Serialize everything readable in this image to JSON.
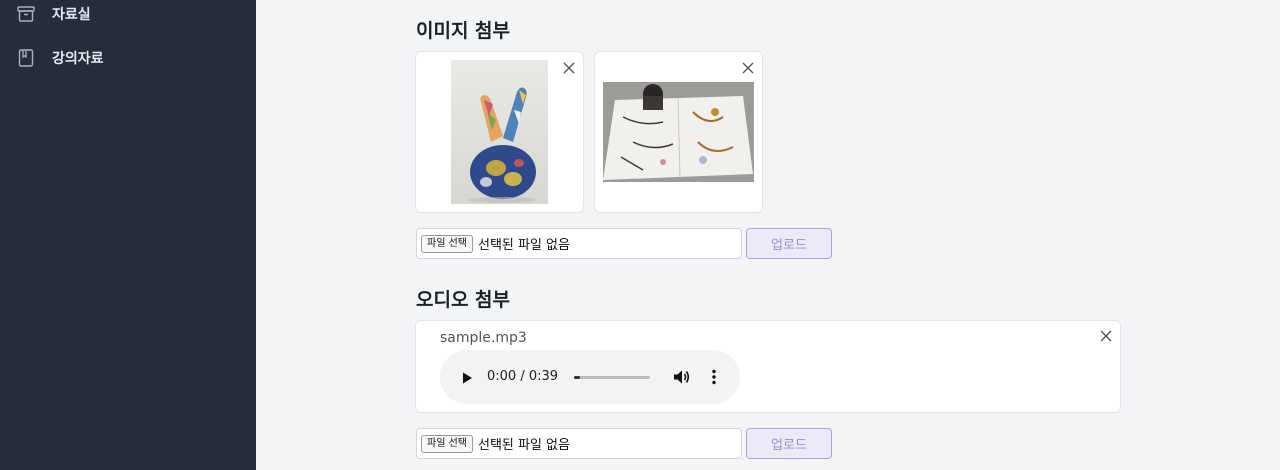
{
  "sidebar": {
    "items": [
      {
        "label": "자료실",
        "icon": "archive-box-icon"
      },
      {
        "label": "강의자료",
        "icon": "book-icon"
      }
    ]
  },
  "image_section": {
    "title": "이미지 첨부",
    "images": [
      {
        "alt": "Painted sculpture of a hand making a peace sign"
      },
      {
        "alt": "Person painting on a large paper on the floor"
      }
    ],
    "file_input": {
      "button": "파일 선택",
      "status": "선택된 파일 없음"
    },
    "upload_label": "업로드"
  },
  "audio_section": {
    "title": "오디오 첨부",
    "file_name": "sample.mp3",
    "player": {
      "time": "0:00 / 0:39",
      "progress": 0.08
    },
    "file_input": {
      "button": "파일 선택",
      "status": "선택된 파일 없음"
    },
    "upload_label": "업로드"
  }
}
